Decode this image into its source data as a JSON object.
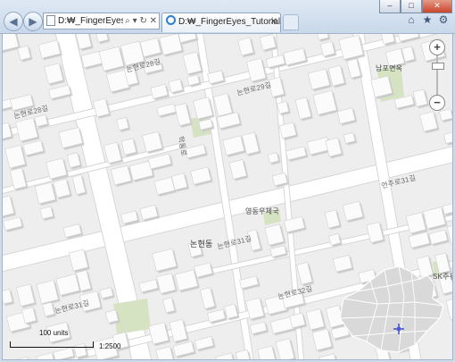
{
  "window": {
    "min_label": "–",
    "max_label": "□",
    "close_label": "✕"
  },
  "toolbar": {
    "back_glyph": "◀",
    "forward_glyph": "▶",
    "address": "D:₩_FingerEyes_Tu",
    "address_tools": "⌕ ▾ ↻ ✕",
    "tab_title": "D:₩_FingerEyes_Tutorials_...",
    "tab_close": "✕",
    "home_icon": "⌂",
    "favorites_icon": "★",
    "tools_icon": "⚙"
  },
  "map": {
    "labels": [
      {
        "text": "논현로28길",
        "name": "street-label-28"
      },
      {
        "text": "논현로29길",
        "name": "street-label-29"
      },
      {
        "text": "논현로28길",
        "name": "street-label-28-left"
      },
      {
        "text": "논현로31길",
        "name": "street-label-31"
      },
      {
        "text": "논현로32길",
        "name": "street-label-32"
      },
      {
        "text": "논현로31길",
        "name": "street-label-31-bottom"
      },
      {
        "text": "언주로31길",
        "name": "street-label-eonju"
      },
      {
        "text": "학동로",
        "name": "street-label-hakdong"
      }
    ],
    "district": "논현동",
    "poi_post_office": "영동우체국",
    "poi_top_right": "남포면옥",
    "poi_sk": "SK주유",
    "zoom_in": "+",
    "zoom_out": "−",
    "scale_units": "100 units",
    "scale_ratio": "1:2500"
  }
}
